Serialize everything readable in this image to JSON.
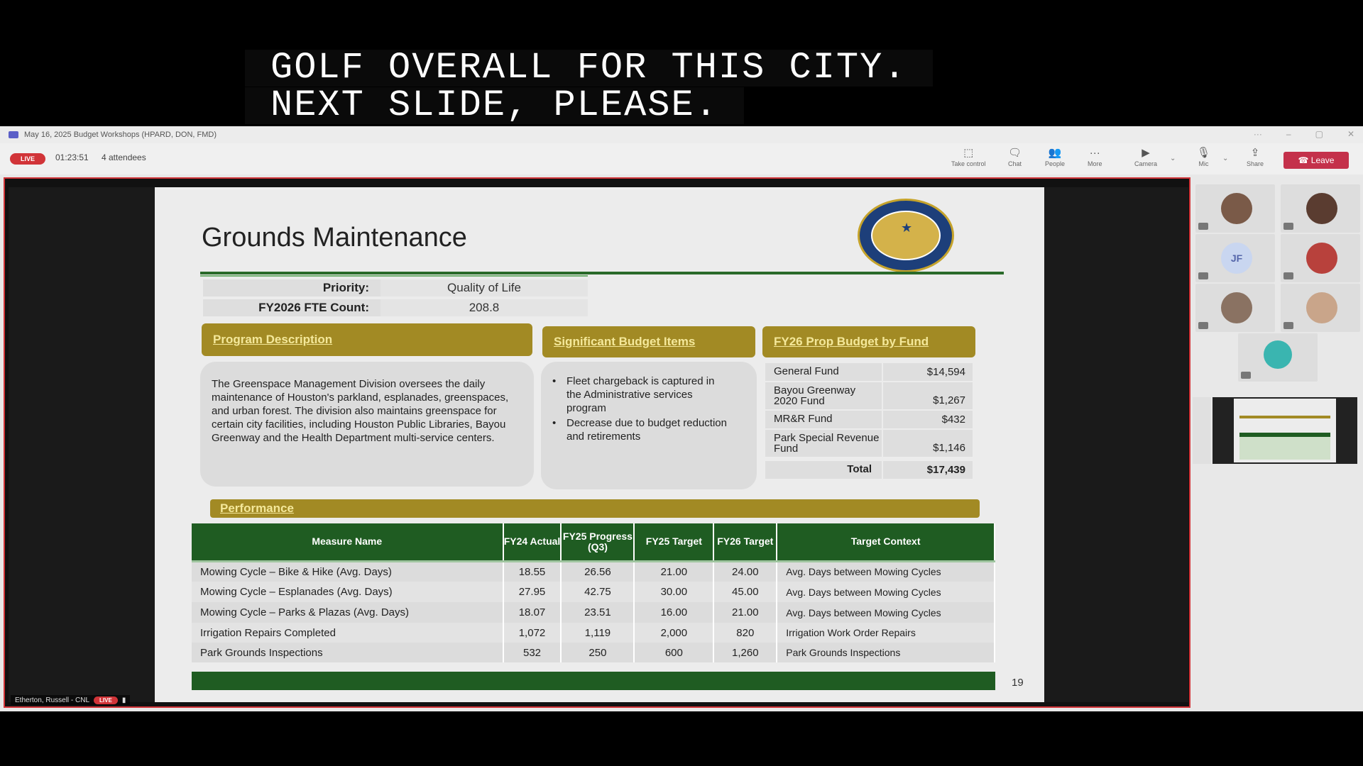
{
  "caption": {
    "line1": "GOLF OVERALL FOR THIS CITY.",
    "line2": "NEXT SLIDE, PLEASE."
  },
  "window": {
    "title": "May 16, 2025 Budget Workshops (HPARD, DON, FMD)"
  },
  "meeting": {
    "live_label": "LIVE",
    "elapsed": "01:23:51",
    "attendees": "4 attendees",
    "toolbar": {
      "take_control": "Take control",
      "chat": "Chat",
      "people": "People",
      "more": "More",
      "camera": "Camera",
      "mic": "Mic",
      "share": "Share",
      "leave": "Leave"
    },
    "presenter_name": "Etherton, Russell - CNL",
    "presenter_live": "LIVE"
  },
  "slide": {
    "title": "Grounds Maintenance",
    "priority_label": "Priority:",
    "priority_value": "Quality of Life",
    "fte_label": "FY2026 FTE Count:",
    "fte_value": "208.8",
    "program_description_header": "Program Description",
    "program_description": "The Greenspace Management Division oversees the daily maintenance of Houston's parkland, esplanades, greenspaces, and urban forest.  The division also maintains greenspace for certain city facilities, including Houston Public Libraries, Bayou Greenway and the Health Department multi-service centers.",
    "budget_items_header": "Significant Budget Items",
    "budget_items": [
      "Fleet chargeback is captured in the Administrative services program",
      "Decrease due to budget reduction and retirements"
    ],
    "fund_header": "FY26 Prop Budget by Fund",
    "funds": [
      {
        "name": "General Fund",
        "amount": "$14,594"
      },
      {
        "name": "Bayou Greenway 2020 Fund",
        "amount": "$1,267"
      },
      {
        "name": "MR&R Fund",
        "amount": "$432"
      },
      {
        "name": "Park Special Revenue Fund",
        "amount": "$1,146"
      }
    ],
    "fund_total_label": "Total",
    "fund_total": "$17,439",
    "performance_header": "Performance",
    "perf_columns": [
      "Measure Name",
      "FY24 Actual",
      "FY25 Progress (Q3)",
      "FY25 Target",
      "FY26 Target",
      "Target Context"
    ],
    "perf_rows": [
      [
        "Mowing Cycle – Bike & Hike (Avg. Days)",
        "18.55",
        "26.56",
        "21.00",
        "24.00",
        "Avg. Days between Mowing Cycles"
      ],
      [
        "Mowing Cycle – Esplanades (Avg. Days)",
        "27.95",
        "42.75",
        "30.00",
        "45.00",
        "Avg. Days between Mowing Cycles"
      ],
      [
        "Mowing Cycle – Parks & Plazas (Avg. Days)",
        "18.07",
        "23.51",
        "16.00",
        "21.00",
        "Avg. Days between Mowing Cycles"
      ],
      [
        "Irrigation Repairs Completed",
        "1,072",
        "1,119",
        "2,000",
        "820",
        "Irrigation Work Order Repairs"
      ],
      [
        "Park Grounds Inspections",
        "532",
        "250",
        "600",
        "1,260",
        "Park Grounds Inspections"
      ]
    ],
    "page_number": "19"
  },
  "gallery": {
    "initials": "JF"
  },
  "colors": {
    "live_red": "#d13438",
    "slide_gold": "#a28a24",
    "slide_green": "#1f5c22"
  }
}
